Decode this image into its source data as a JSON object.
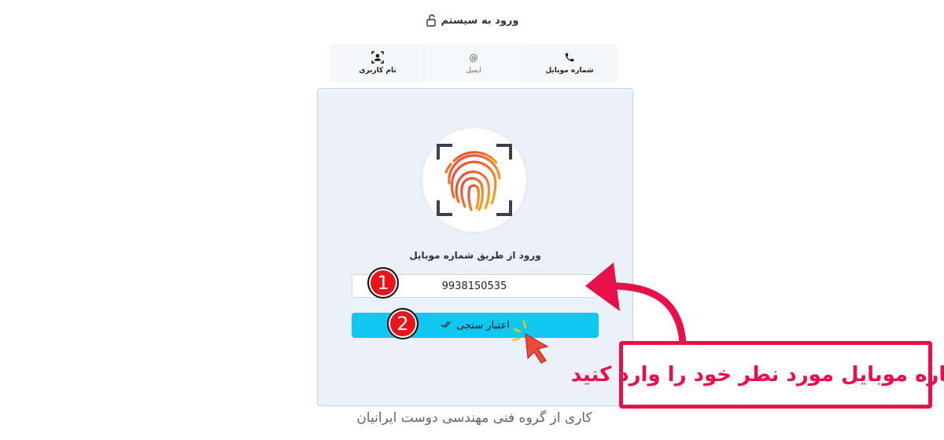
{
  "header": {
    "title": "ورود به سیستم",
    "icon": "unlock-icon"
  },
  "tabs": [
    {
      "label": "شماره موبایل",
      "icon": "phone-icon",
      "active": true
    },
    {
      "label": "ایمیل",
      "icon": "at-icon",
      "active": false
    },
    {
      "label": "نام کاربری",
      "icon": "user-scan-icon",
      "active": true
    }
  ],
  "card": {
    "image": "fingerprint-icon",
    "subtitle": "ورود از طریق شماره موبایل",
    "phone_value": "9938150535",
    "verify_label": "اعتبار سنجی",
    "verify_icon": "double-check-icon"
  },
  "footer": {
    "text": "کاری از گروه فنی مهندسی دوست ایرانیان"
  },
  "annotations": {
    "badge_1": "1",
    "badge_2": "2",
    "callout": "شماره موبایل مورد نطر خود را وارد کنید",
    "accent_color": "#e8104a",
    "button_color": "#10c8ef"
  }
}
